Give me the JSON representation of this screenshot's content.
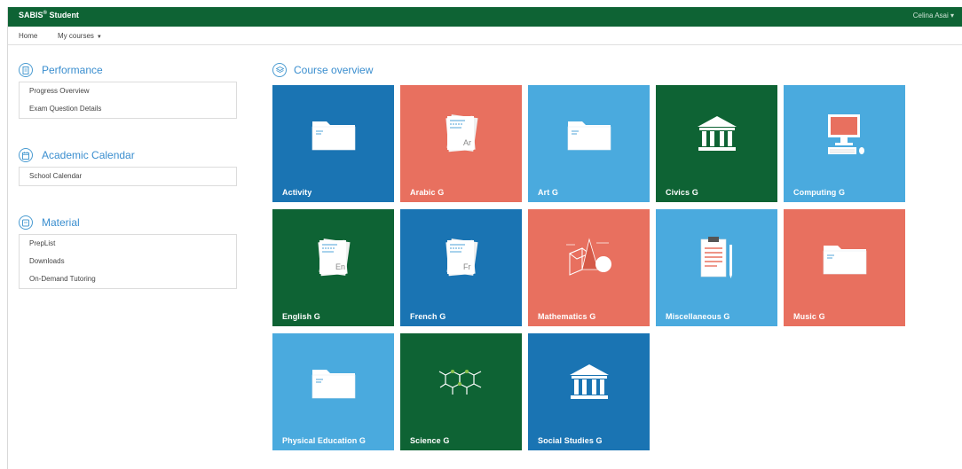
{
  "topbar": {
    "brand": "SABIS",
    "brand_sup": "®",
    "brand_suffix": " Student",
    "user": "Celina Asai ▾"
  },
  "nav": {
    "home": "Home",
    "my_courses": "My courses"
  },
  "sidebar": {
    "performance": {
      "title": "Performance",
      "items": [
        "Progress Overview",
        "Exam Question Details"
      ]
    },
    "calendar": {
      "title": "Academic Calendar",
      "items": [
        "School Calendar"
      ]
    },
    "material": {
      "title": "Material",
      "items": [
        "PrepList",
        "Downloads",
        "On-Demand Tutoring"
      ]
    }
  },
  "overview": {
    "title": "Course overview",
    "tiles": [
      {
        "label": "Activity",
        "color": "#1a74b3",
        "icon": "folder-icon"
      },
      {
        "label": "Arabic G",
        "color": "#e8705f",
        "icon": "document-icon",
        "doc_text": "Ar"
      },
      {
        "label": "Art G",
        "color": "#4aaade",
        "icon": "folder-icon"
      },
      {
        "label": "Civics G",
        "color": "#0e6334",
        "icon": "building-icon"
      },
      {
        "label": "Computing G",
        "color": "#4aaade",
        "icon": "computer-icon"
      },
      {
        "label": "English G",
        "color": "#0e6334",
        "icon": "document-icon",
        "doc_text": "En"
      },
      {
        "label": "French G",
        "color": "#1a74b3",
        "icon": "document-icon",
        "doc_text": "Fr"
      },
      {
        "label": "Mathematics G",
        "color": "#e8705f",
        "icon": "geometry-icon"
      },
      {
        "label": "Miscellaneous G",
        "color": "#4aaade",
        "icon": "clipboard-icon"
      },
      {
        "label": "Music G",
        "color": "#e8705f",
        "icon": "folder-icon"
      },
      {
        "label": "Physical Education G",
        "color": "#4aaade",
        "icon": "folder-icon"
      },
      {
        "label": "Science G",
        "color": "#0e6334",
        "icon": "molecule-icon"
      },
      {
        "label": "Social Studies G",
        "color": "#1a74b3",
        "icon": "building-icon"
      }
    ]
  }
}
